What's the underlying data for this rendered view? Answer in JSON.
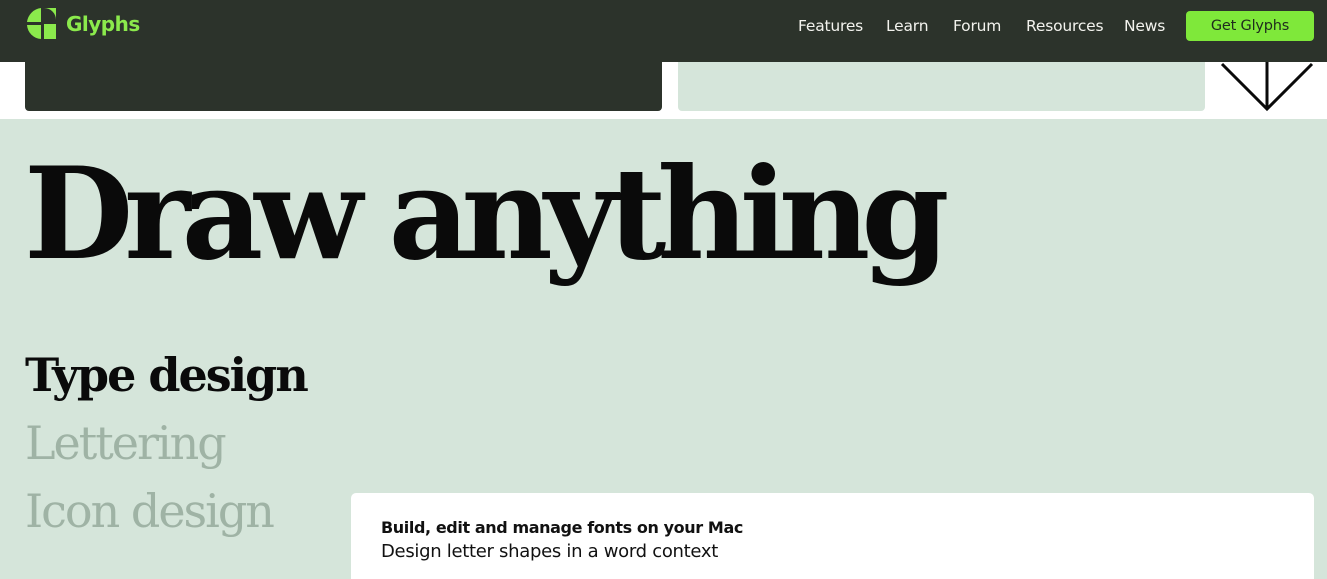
{
  "brand": {
    "name": "Glyphs",
    "accent": "#8bea4c",
    "cta_color": "#7fe83a",
    "nav_bg": "#2c332b",
    "hero_bg": "#d5e5da"
  },
  "nav": {
    "links": [
      "Features",
      "Learn",
      "Forum",
      "Resources",
      "News"
    ],
    "cta_label": "Get Glyphs"
  },
  "hero": {
    "headline": "Draw anything",
    "categories": [
      {
        "label": "Type design",
        "active": true
      },
      {
        "label": "Lettering",
        "active": false
      },
      {
        "label": "Icon design",
        "active": false
      }
    ],
    "feature": {
      "title": "Build, edit and manage fonts on your Mac",
      "subtitle": "Design letter shapes in a word context"
    }
  },
  "icons": {
    "logo": "glyphs-logo-icon",
    "arrow": "arrow-down-icon"
  }
}
